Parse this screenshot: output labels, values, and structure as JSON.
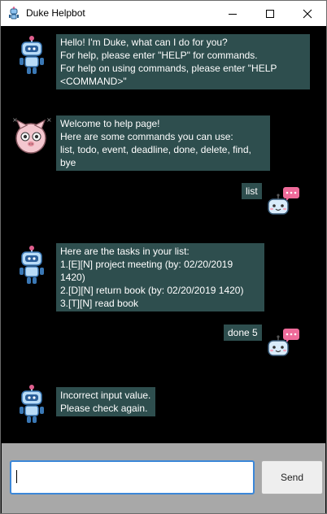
{
  "window": {
    "title": "Duke Helpbot"
  },
  "messages": [
    {
      "sender": "duke",
      "avatar": "robot-icon",
      "text": "Hello! I'm Duke, what can I do for you?\nFor help, please enter \"HELP\" for commands.\nFor help on using commands, please enter \"HELP\n<COMMAND>\""
    },
    {
      "sender": "duke",
      "avatar": "pig-icon",
      "text": "Welcome to help page!\nHere are some commands you can use:\nlist, todo, event, deadline, done, delete, find, bye"
    },
    {
      "sender": "user",
      "avatar": "chat-robot-icon",
      "text": "list"
    },
    {
      "sender": "duke",
      "avatar": "robot-icon",
      "text": "Here are the tasks in your list:\n1.[E][N] project meeting (by: 02/20/2019 1420)\n2.[D][N] return book (by: 02/20/2019 1420)\n3.[T][N] read book"
    },
    {
      "sender": "user",
      "avatar": "chat-robot-icon",
      "text": "done 5"
    },
    {
      "sender": "duke",
      "avatar": "robot-icon",
      "text": "Incorrect input value.\nPlease check again."
    }
  ],
  "input": {
    "value": "",
    "placeholder": ""
  },
  "send_button": {
    "label": "Send"
  },
  "colors": {
    "bubble": "#2e4e4e",
    "chat_background": "#000000",
    "input_border": "#3b87d8"
  }
}
